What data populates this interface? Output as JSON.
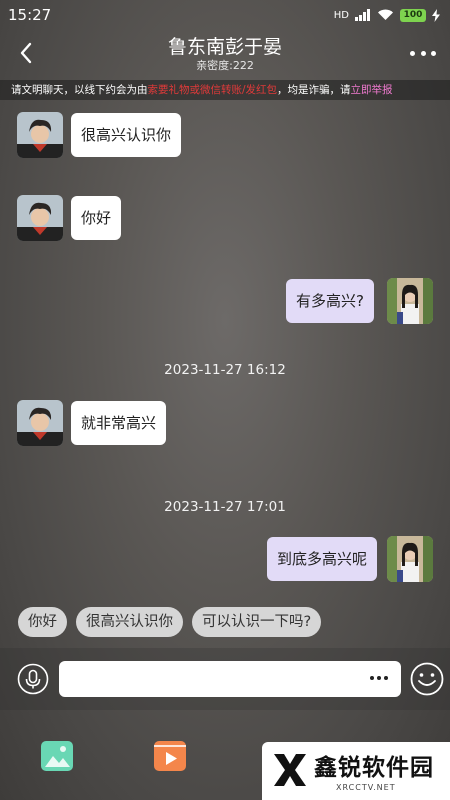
{
  "status_bar": {
    "time": "15:27",
    "network": "HD",
    "battery": "100"
  },
  "header": {
    "title": "鲁东南彭于晏",
    "subtitle": "亲密度:222"
  },
  "notice": {
    "part1": "请文明聊天，以线下约会为由",
    "part2": "索要礼物或微信转账/发红包",
    "part3": "，均是诈骗，请",
    "part4": "立即举报"
  },
  "messages": [
    {
      "side": "left",
      "text": "很高兴认识你"
    },
    {
      "side": "left",
      "text": "你好"
    },
    {
      "side": "right",
      "text": "有多高兴?"
    },
    {
      "type": "time",
      "text": "2023-11-27 16:12"
    },
    {
      "side": "left",
      "text": "就非常高兴"
    },
    {
      "type": "time",
      "text": "2023-11-27 17:01"
    },
    {
      "side": "right",
      "text": "到底多高兴呢"
    }
  ],
  "quick_replies": [
    "你好",
    "很高兴认识你",
    "可以认识一下吗?"
  ],
  "input": {
    "placeholder": ""
  },
  "watermark": {
    "brand": "鑫锐软件园",
    "url": "XRCCTV.NET"
  },
  "colors": {
    "left_bubble": "#ffffff",
    "right_bubble": "#e2dbf7",
    "notice_red": "#e23a3a",
    "notice_pink": "#f07ad0"
  },
  "icons": [
    "back-arrow-icon",
    "more-dots-icon",
    "mic-icon",
    "emoji-icon",
    "image-icon",
    "video-icon",
    "gift-icon"
  ]
}
